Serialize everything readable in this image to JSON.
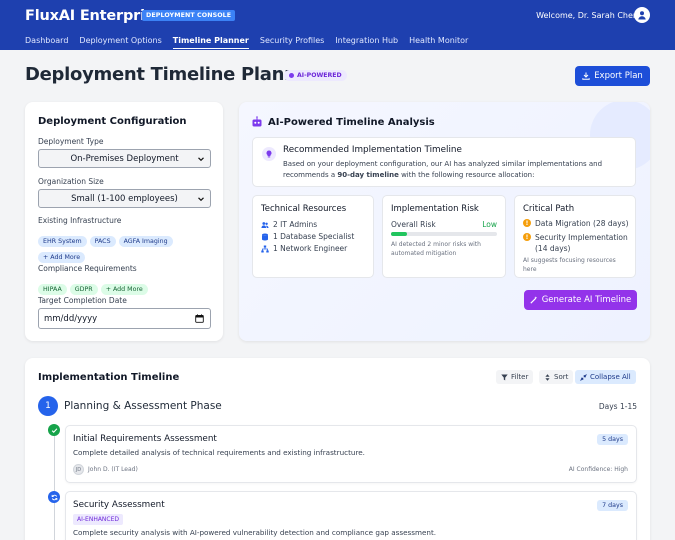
{
  "header": {
    "brand": "FluxAI Enterprise",
    "brand_tag": "DEPLOYMENT CONSOLE",
    "welcome": "Welcome, Dr. Sarah Chen",
    "nav": [
      "Dashboard",
      "Deployment Options",
      "Timeline Planner",
      "Security Profiles",
      "Integration Hub",
      "Health Monitor"
    ],
    "active_nav": "Timeline Planner"
  },
  "page": {
    "title": "Deployment Timeline Planner",
    "badge": "AI-POWERED",
    "export_label": "Export Plan"
  },
  "config": {
    "title": "Deployment Configuration",
    "deployment_type_label": "Deployment Type",
    "deployment_type_value": "On-Premises Deployment",
    "org_size_label": "Organization Size",
    "org_size_value": "Small (1-100 employees)",
    "infra_label": "Existing Infrastructure",
    "infra_chips": [
      "EHR System",
      "PACS",
      "AGFA Imaging"
    ],
    "infra_add": "+ Add More",
    "compliance_label": "Compliance Requirements",
    "compliance_chips": [
      "HIPAA",
      "GDPR"
    ],
    "compliance_add": "+ Add More",
    "date_label": "Target Completion Date",
    "date_placeholder": "mm/dd/yyyy"
  },
  "ai": {
    "title": "AI-Powered Timeline Analysis",
    "rec_title": "Recommended Implementation Timeline",
    "rec_body_1": "Based on your deployment configuration, our AI has analyzed similar implementations and",
    "rec_body_2a": "recommends a ",
    "rec_body_2b": "90-day timeline",
    "rec_body_2c": " with the following resource allocation:",
    "resources": {
      "title": "Technical Resources",
      "items": [
        "2 IT Admins",
        "1 Database Specialist",
        "1 Network Engineer"
      ]
    },
    "risk": {
      "title": "Implementation Risk",
      "overall_label": "Overall Risk",
      "overall_value": "Low",
      "level": 0.15,
      "note": "AI detected 2 minor risks with automated mitigation"
    },
    "critical": {
      "title": "Critical Path",
      "items": [
        "Data Migration (28 days)",
        "Security Implementation (14 days)"
      ],
      "note": "AI suggests focusing resources here"
    },
    "generate_label": "Generate AI Timeline"
  },
  "timeline": {
    "title": "Implementation Timeline",
    "filter": "Filter",
    "sort": "Sort",
    "collapse": "Collapse All",
    "phase": {
      "number": "1",
      "title": "Planning & Assessment Phase",
      "days": "Days 1-15"
    },
    "tasks": [
      {
        "title": "Initial Requirements Assessment",
        "desc": "Complete detailed analysis of technical requirements and existing infrastructure.",
        "days": "5 days",
        "owner_initials": "JD",
        "owner": "John D. (IT Lead)",
        "confidence": "AI Confidence: High"
      },
      {
        "title": "Security Assessment",
        "tag": "AI-ENHANCED",
        "desc": "Complete security analysis with AI-powered vulnerability detection and compliance gap assessment.",
        "days": "7 days"
      }
    ]
  }
}
